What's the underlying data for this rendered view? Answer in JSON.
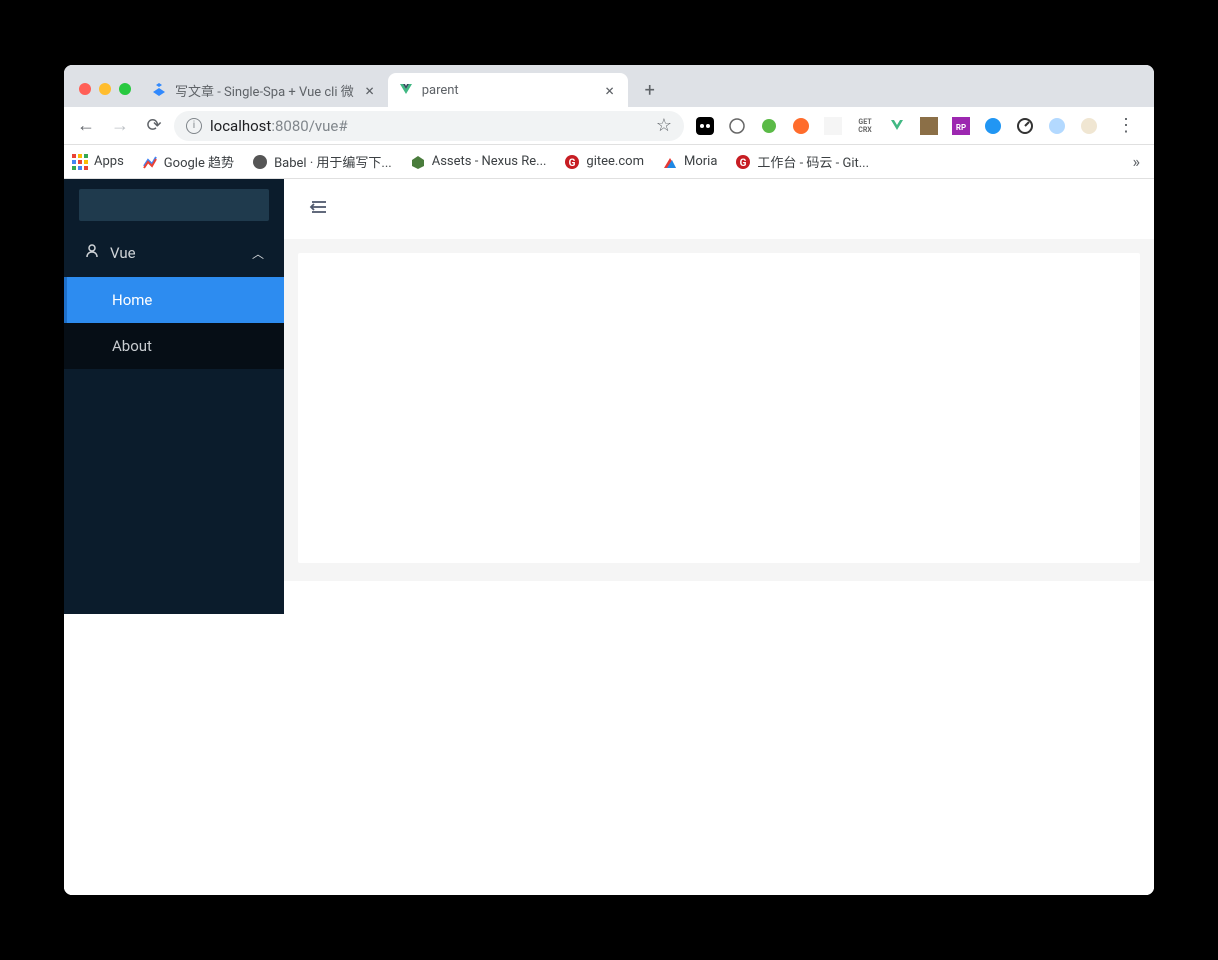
{
  "tabs": [
    {
      "title": "写文章 - Single-Spa + Vue cli 微",
      "active": false
    },
    {
      "title": "parent",
      "active": true
    }
  ],
  "url": {
    "host": "localhost",
    "port": ":8080",
    "path": "/vue#"
  },
  "bookmarks": {
    "apps": "Apps",
    "items": [
      {
        "label": "Google 趋势"
      },
      {
        "label": "Babel · 用于编写下..."
      },
      {
        "label": "Assets - Nexus Re..."
      },
      {
        "label": "gitee.com"
      },
      {
        "label": "Moria"
      },
      {
        "label": "工作台 - 码云 - Git..."
      }
    ]
  },
  "sidebar": {
    "group_label": "Vue",
    "items": [
      {
        "label": "Home",
        "active": true
      },
      {
        "label": "About",
        "active": false
      }
    ]
  }
}
